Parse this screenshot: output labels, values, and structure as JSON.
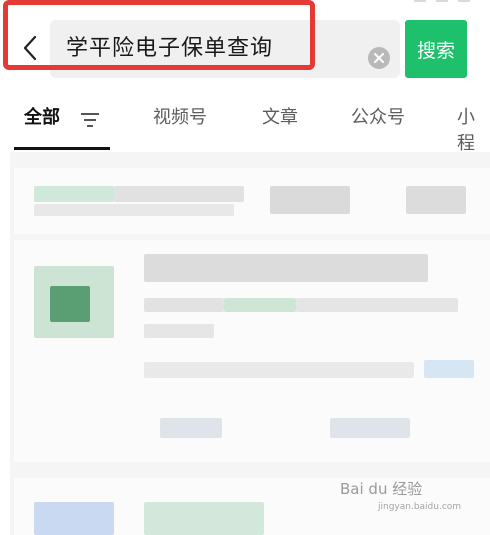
{
  "search": {
    "query": "学平险电子保单查询",
    "submit_label": "搜索"
  },
  "tabs": [
    {
      "label": "全部",
      "active": true
    },
    {
      "label": "视频号"
    },
    {
      "label": "文章"
    },
    {
      "label": "公众号"
    },
    {
      "label": "小程"
    }
  ],
  "watermark": {
    "brand": "Bai du 经验",
    "domain": "jingyan.baidu.com"
  },
  "colors": {
    "accent": "#1ec06b",
    "highlight": "#e53935"
  },
  "icons": {
    "back": "chevron-left-icon",
    "clear": "clear-icon",
    "filter": "filter-icon"
  }
}
